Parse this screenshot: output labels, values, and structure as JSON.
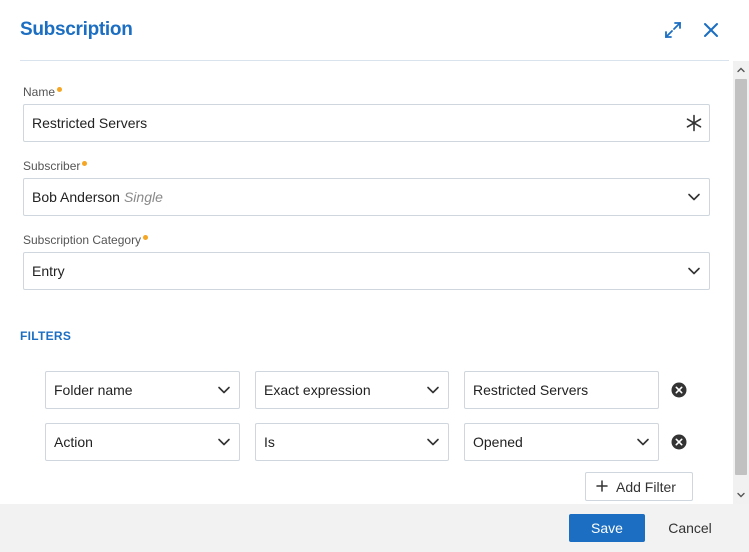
{
  "dialog": {
    "title": "Subscription"
  },
  "form": {
    "name": {
      "label": "Name",
      "value": "Restricted Servers"
    },
    "subscriber": {
      "label": "Subscriber",
      "value": "Bob Anderson",
      "type": "Single"
    },
    "category": {
      "label": "Subscription Category",
      "value": "Entry"
    }
  },
  "filters": {
    "heading": "FILTERS",
    "rows": [
      {
        "field": "Folder name",
        "operator": "Exact expression",
        "value": "Restricted Servers"
      },
      {
        "field": "Action",
        "operator": "Is",
        "value": "Opened"
      }
    ],
    "add_label": "Add Filter"
  },
  "footer": {
    "save_label": "Save",
    "cancel_label": "Cancel"
  },
  "colors": {
    "accent": "#1b6ec2",
    "required": "#f5a623"
  }
}
